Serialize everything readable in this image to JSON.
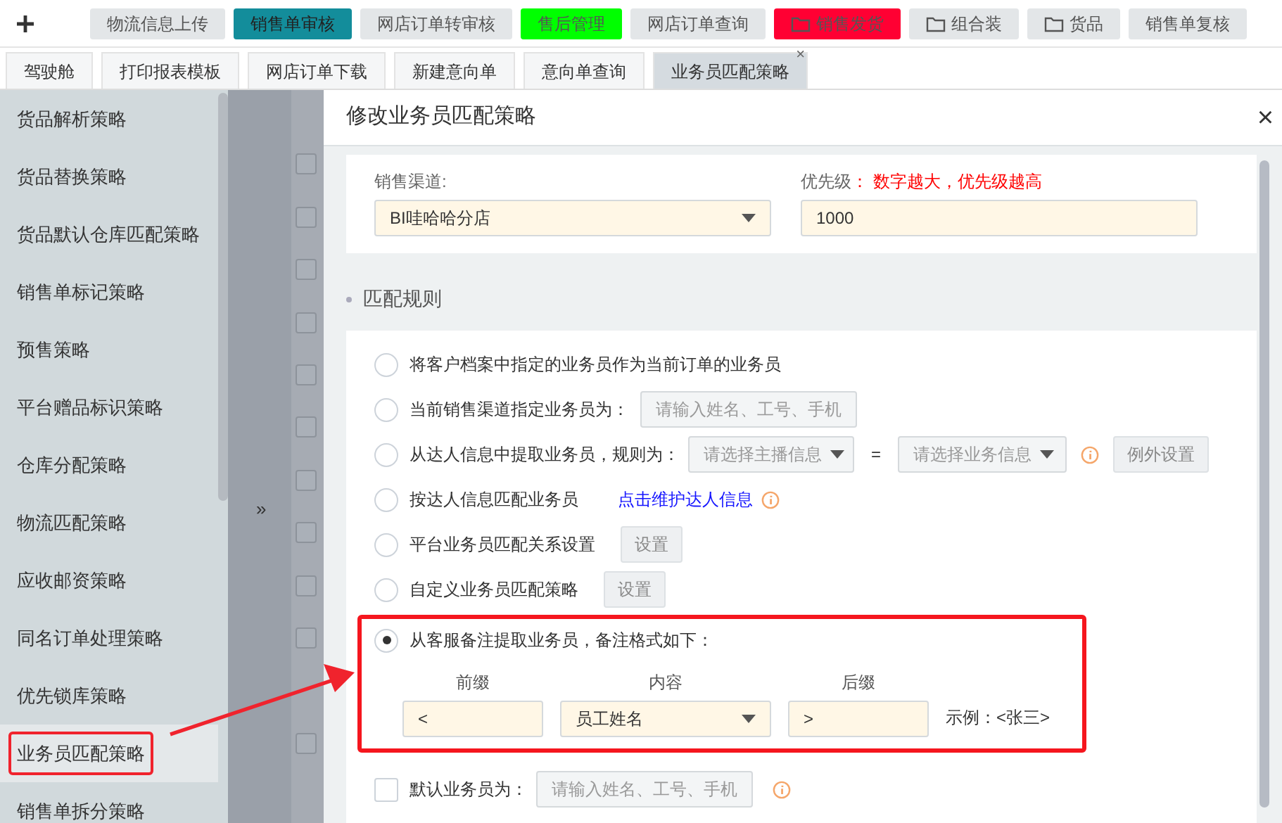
{
  "top_menu": [
    {
      "label": "物流信息上传",
      "color": "#e3e6e8",
      "kind": "plain",
      "selected": false
    },
    {
      "label": "销售单审核",
      "color": "#138d9b",
      "kind": "plain",
      "selected": true
    },
    {
      "label": "网店订单转审核",
      "color": "#e3e6e8",
      "kind": "plain",
      "selected": false
    },
    {
      "label": "售后管理",
      "color": "#00ff00",
      "kind": "plain",
      "selected": false
    },
    {
      "label": "网店订单查询",
      "color": "#e3e6e8",
      "kind": "plain",
      "selected": false
    },
    {
      "label": "销售发货",
      "color": "#ff0033",
      "kind": "folder",
      "selected": false
    },
    {
      "label": "组合装",
      "color": "#e3e6e8",
      "kind": "folder",
      "selected": false
    },
    {
      "label": "货品",
      "color": "#e3e6e8",
      "kind": "folder",
      "selected": false
    },
    {
      "label": "销售单复核",
      "color": "#e3e6e8",
      "kind": "plain",
      "selected": false
    }
  ],
  "tabs": [
    {
      "label": "驾驶舱",
      "selected": false
    },
    {
      "label": "打印报表模板",
      "selected": false
    },
    {
      "label": "网店订单下载",
      "selected": false
    },
    {
      "label": "新建意向单",
      "selected": false
    },
    {
      "label": "意向单查询",
      "selected": false
    },
    {
      "label": "业务员匹配策略",
      "selected": true,
      "close": "×"
    }
  ],
  "background_table": {
    "rows": [
      {
        "checked": false
      },
      {
        "checked": false
      },
      {
        "checked": false
      },
      {
        "checked": false
      },
      {
        "checked": false
      },
      {
        "checked": false
      },
      {
        "checked": false
      },
      {
        "checked": false
      },
      {
        "checked": false
      },
      {
        "checked": false
      },
      {
        "checked": false
      }
    ]
  },
  "sidebar": {
    "items": [
      {
        "label": "货品解析策略",
        "selected": false
      },
      {
        "label": "货品替换策略",
        "selected": false
      },
      {
        "label": "货品默认仓库匹配策略",
        "selected": false
      },
      {
        "label": "销售单标记策略",
        "selected": false
      },
      {
        "label": "预售策略",
        "selected": false
      },
      {
        "label": "平台赠品标识策略",
        "selected": false
      },
      {
        "label": "仓库分配策略",
        "selected": false
      },
      {
        "label": "物流匹配策略",
        "selected": false
      },
      {
        "label": "应收邮资策略",
        "selected": false
      },
      {
        "label": "同名订单处理策略",
        "selected": false
      },
      {
        "label": "优先锁库策略",
        "selected": false
      },
      {
        "label": "业务员匹配策略",
        "selected": true,
        "highlighted": true
      },
      {
        "label": "销售单拆分策略",
        "selected": false
      }
    ],
    "collapse": "»"
  },
  "dialog": {
    "title": "修改业务员匹配策略",
    "close": "×",
    "channel": {
      "label": "销售渠道:",
      "value": "BI哇哈哈分店"
    },
    "priority": {
      "label": "优先级",
      "hint": "： 数字越大，优先级越高",
      "value": "1000"
    },
    "section": "匹配规则",
    "rules": [
      {
        "kind": "plain",
        "label": "将客户档案中指定的业务员作为当前订单的业务员",
        "selected": false
      },
      {
        "kind": "input",
        "label": "当前销售渠道指定业务员为：",
        "selected": false,
        "placeholder": "请输入姓名、工号、手机"
      },
      {
        "kind": "mapping",
        "label": "从达人信息中提取业务员，规则为：",
        "selected": false,
        "select_1": "请选择主播信息",
        "equals": "=",
        "select_2": "请选择业务信息",
        "button": "例外设置"
      },
      {
        "kind": "link",
        "label": "按达人信息匹配业务员",
        "selected": false,
        "link": "点击维护达人信息"
      },
      {
        "kind": "button",
        "label": "平台业务员匹配关系设置",
        "selected": false,
        "button": "设置"
      },
      {
        "kind": "button",
        "label": "自定义业务员匹配策略",
        "selected": false,
        "button": "设置"
      },
      {
        "kind": "format",
        "label": "从客服备注提取业务员，备注格式如下：",
        "selected": true,
        "highlighted": true,
        "prefix_label": "前缀",
        "prefix": "<",
        "content_label": "内容",
        "content": "员工姓名",
        "suffix_label": "后缀",
        "suffix": ">",
        "example": "示例：<张三>"
      }
    ],
    "default": {
      "label": "默认业务员为：",
      "checked": false,
      "placeholder": "请输入姓名、工号、手机"
    }
  },
  "annotation_arrow": true
}
